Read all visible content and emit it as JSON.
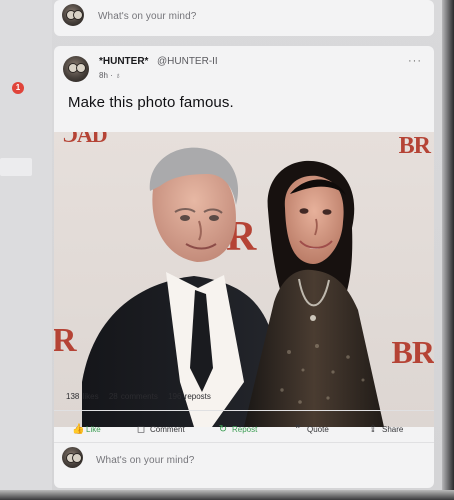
{
  "colors": {
    "brand": "#3d9e54",
    "badge": "#e0443a",
    "backdrop_letters": "#b54335"
  },
  "left_rail": {
    "notification_count": "1"
  },
  "composer": {
    "placeholder": "What's on your mind?"
  },
  "post": {
    "display_name": "*HUNTER*",
    "handle": "@HUNTER-II",
    "meta": "8h · ♁",
    "more_label": "···",
    "text": "Make this photo famous.",
    "photo": {
      "backdrop_letters": {
        "top_left": "ƆAD",
        "top_right": "BR",
        "middle": "R",
        "left_bottom": "R",
        "right_bottom": "BR"
      }
    },
    "stats": {
      "likes": "138 likes",
      "comments": "28 comments",
      "reposts": "196 reposts"
    },
    "actions": [
      {
        "label": "Like",
        "icon": "thumbs-up-icon"
      },
      {
        "label": "Comment",
        "icon": "comment-icon"
      },
      {
        "label": "Repost",
        "icon": "repost-icon"
      },
      {
        "label": "Quote",
        "icon": "quote-icon"
      },
      {
        "label": "Share",
        "icon": "share-icon"
      }
    ]
  },
  "bottom_composer": {
    "placeholder": "What's on your mind?"
  }
}
